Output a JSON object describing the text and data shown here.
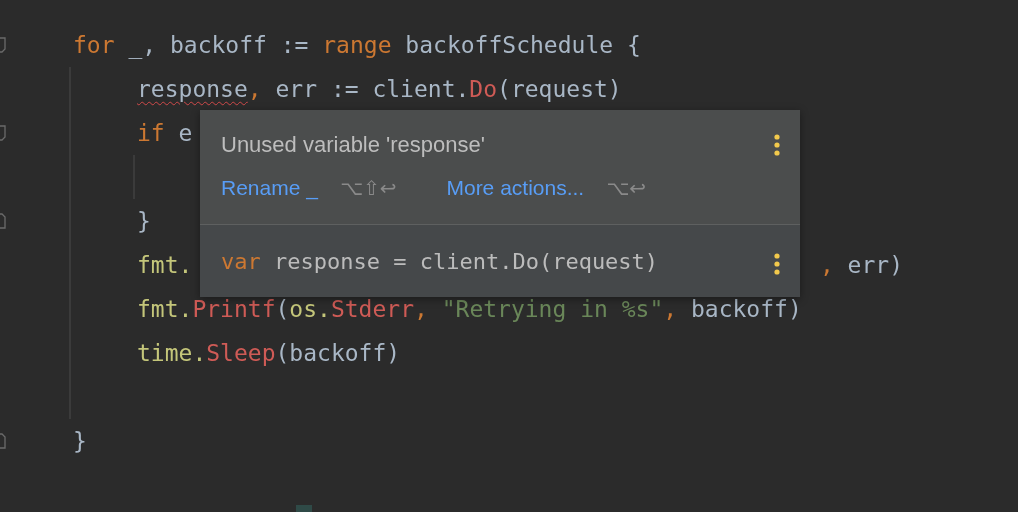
{
  "editor": {
    "lines": [
      {
        "fold_start": true,
        "tokens": [
          {
            "text": "for",
            "kind": "keyword"
          },
          {
            "text": " _, backoff := ",
            "kind": "plain"
          },
          {
            "text": "range",
            "kind": "keyword"
          },
          {
            "text": " backoffSchedule {",
            "kind": "plain"
          }
        ],
        "children": [
          {
            "tokens": [
              {
                "text": "response",
                "kind": "warning"
              },
              {
                "text": ",",
                "kind": "punct"
              },
              {
                "text": " err := client.",
                "kind": "plain"
              },
              {
                "text": "Do",
                "kind": "call"
              },
              {
                "text": "(request)",
                "kind": "plain"
              }
            ]
          },
          {
            "fold_start": true,
            "tokens": [
              {
                "text": "if",
                "kind": "keyword"
              },
              {
                "text": " e",
                "kind": "plain"
              }
            ],
            "children": [
              {
                "kind": "blank"
              }
            ]
          },
          {
            "fold_end": true,
            "tokens": [
              {
                "text": "}",
                "kind": "plain"
              }
            ]
          },
          {
            "tokens": [
              {
                "text": "fmt.",
                "kind": "pkg"
              }
            ],
            "tail": [
              {
                "text": ",",
                "kind": "punct"
              },
              {
                "text": " err)",
                "kind": "plain"
              }
            ]
          },
          {
            "tokens": [
              {
                "text": "fmt.",
                "kind": "pkg"
              },
              {
                "text": "Printf",
                "kind": "call"
              },
              {
                "text": "(",
                "kind": "plain"
              },
              {
                "text": "os.",
                "kind": "pkg"
              },
              {
                "text": "Stderr",
                "kind": "call"
              },
              {
                "text": ",",
                "kind": "punct"
              },
              {
                "text": " \"Retrying in %s\"",
                "kind": "string"
              },
              {
                "text": ",",
                "kind": "punct"
              },
              {
                "text": " backoff)",
                "kind": "plain"
              }
            ]
          },
          {
            "tokens": [
              {
                "text": "time.",
                "kind": "pkg"
              },
              {
                "text": "Sleep",
                "kind": "call"
              },
              {
                "text": "(backoff)",
                "kind": "plain"
              }
            ]
          },
          {
            "kind": "blank"
          }
        ]
      },
      {
        "fold_end": true,
        "tokens": [
          {
            "text": "}",
            "kind": "plain"
          }
        ]
      }
    ]
  },
  "popup": {
    "title": "Unused variable 'response'",
    "actions": [
      {
        "label": "Rename _",
        "shortcut": "⌥⇧↩"
      },
      {
        "label": "More actions...",
        "shortcut": "⌥↩"
      }
    ],
    "preview": [
      {
        "text": "var",
        "kind": "keyword"
      },
      {
        "text": " response = client.Do(request)",
        "kind": "plain"
      }
    ]
  }
}
